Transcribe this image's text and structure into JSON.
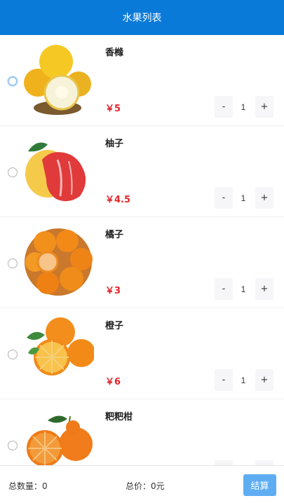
{
  "header": {
    "title": "水果列表"
  },
  "items": [
    {
      "name": "香橼",
      "price": "￥5",
      "qty": "1",
      "minus": "-",
      "plus": "+"
    },
    {
      "name": "柚子",
      "price": "￥4.5",
      "qty": "1",
      "minus": "-",
      "plus": "+"
    },
    {
      "name": "橘子",
      "price": "￥3",
      "qty": "1",
      "minus": "-",
      "plus": "+"
    },
    {
      "name": "橙子",
      "price": "￥6",
      "qty": "1",
      "minus": "-",
      "plus": "+"
    },
    {
      "name": "粑粑柑",
      "price": "",
      "qty": "",
      "minus": "",
      "plus": ""
    }
  ],
  "footer": {
    "total_count": "总数量：0",
    "total_price": "总价：0元",
    "checkout_label": "结算"
  },
  "colors": {
    "header_bg": "#0a7ad8",
    "price": "#e5262c",
    "checkout_bg": "#5eadf3"
  }
}
